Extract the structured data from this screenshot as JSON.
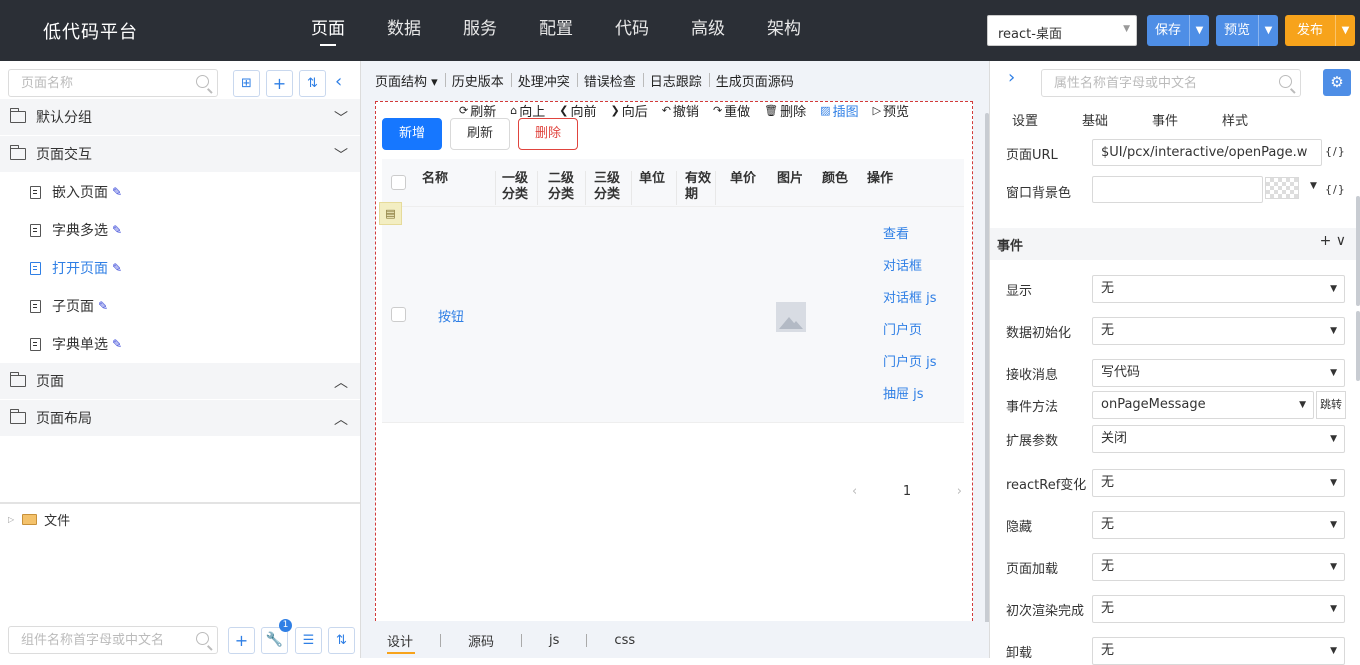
{
  "app": {
    "title": "低代码平台"
  },
  "nav": {
    "items": [
      "页面",
      "数据",
      "服务",
      "配置",
      "代码",
      "高级",
      "架构"
    ],
    "active": "页面"
  },
  "header": {
    "target": "react-桌面",
    "save": "保存",
    "preview": "预览",
    "publish": "发布"
  },
  "left": {
    "page_search_placeholder": "页面名称",
    "groups": [
      {
        "label": "默认分组"
      },
      {
        "label": "页面交互"
      },
      {
        "label": "页面"
      },
      {
        "label": "页面布局"
      }
    ],
    "pages": [
      {
        "label": "嵌入页面"
      },
      {
        "label": "字典多选"
      },
      {
        "label": "打开页面"
      },
      {
        "label": "子页面"
      },
      {
        "label": "字典单选"
      }
    ],
    "file_label": "文件",
    "component_search_placeholder": "组件名称首字母或中文名",
    "badge_count": "1"
  },
  "middle": {
    "toolbar": [
      "页面结构",
      "历史版本",
      "处理冲突",
      "错误检查",
      "日志跟踪",
      "生成页面源码"
    ],
    "canvas_tools": [
      "刷新",
      "向上",
      "向前",
      "向后",
      "撤销",
      "重做",
      "删除",
      "插图",
      "预览"
    ],
    "buttons": {
      "add": "新增",
      "refresh": "刷新",
      "delete": "删除"
    },
    "columns": [
      "名称",
      "一级分类",
      "二级分类",
      "三级分类",
      "单位",
      "有效期",
      "单价",
      "图片",
      "颜色",
      "操作"
    ],
    "row": {
      "name": "按钮"
    },
    "operations": [
      "查看",
      "对话框",
      "对话框 js",
      "门户页",
      "门户页 js",
      "抽屉 js"
    ],
    "page_number": "1",
    "bottom_tabs": [
      "设计",
      "源码",
      "js",
      "css"
    ]
  },
  "right": {
    "search_placeholder": "属性名称首字母或中文名",
    "tabs": [
      "设置",
      "基础",
      "事件",
      "样式"
    ],
    "page_url_label": "页面URL",
    "page_url_value": "$UI/pcx/interactive/openPage.w",
    "bg_label": "窗口背景色",
    "bg_value": "",
    "fx_label": "{/}",
    "events_header": "事件",
    "events_actions": "+ ∨",
    "jump_label": "跳转",
    "events": [
      {
        "label": "显示",
        "value": "无"
      },
      {
        "label": "数据初始化",
        "value": "无"
      },
      {
        "label": "接收消息",
        "value": "写代码"
      },
      {
        "label": "事件方法",
        "value": "onPageMessage"
      },
      {
        "label": "扩展参数",
        "value": "关闭"
      },
      {
        "label": "reactRef变化",
        "value": "无"
      },
      {
        "label": "隐藏",
        "value": "无"
      },
      {
        "label": "页面加载",
        "value": "无"
      },
      {
        "label": "初次渲染完成",
        "value": "无"
      },
      {
        "label": "卸载",
        "value": "无"
      }
    ]
  },
  "colors": {
    "topbar": "#2b2f36",
    "accent_blue": "#4e8ee6",
    "publish_orange": "#f7a31b",
    "danger": "#e0443e",
    "primary": "#1677ff"
  }
}
